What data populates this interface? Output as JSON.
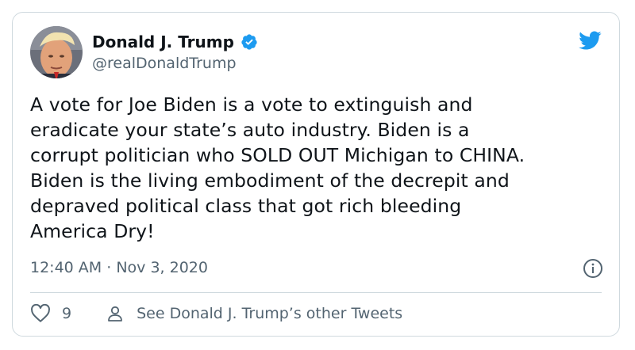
{
  "tweet": {
    "author_name": "Donald J. Trump",
    "handle": "@realDonaldTrump",
    "text_lines": [
      "A vote for Joe Biden is a vote to extinguish and",
      "eradicate your state’s auto industry. Biden is a",
      "corrupt politician who SOLD OUT Michigan to CHINA.",
      "Biden is the living embodiment of the decrepit and",
      "depraved political class that got rich bleeding",
      "America Dry!"
    ],
    "time": "12:40 AM",
    "separator": "·",
    "date": "Nov 3, 2020",
    "like_count": "9",
    "other_tweets_label": "See Donald J. Trump’s other Tweets"
  },
  "icons": {
    "verified": "verified-badge-icon",
    "brand": "twitter-bird-icon",
    "info": "info-icon",
    "like": "heart-icon",
    "profile": "person-icon"
  },
  "colors": {
    "brand_blue": "#1d9bf0",
    "text_primary": "#0f1419",
    "text_secondary": "#536471",
    "border": "#cfd9de"
  }
}
